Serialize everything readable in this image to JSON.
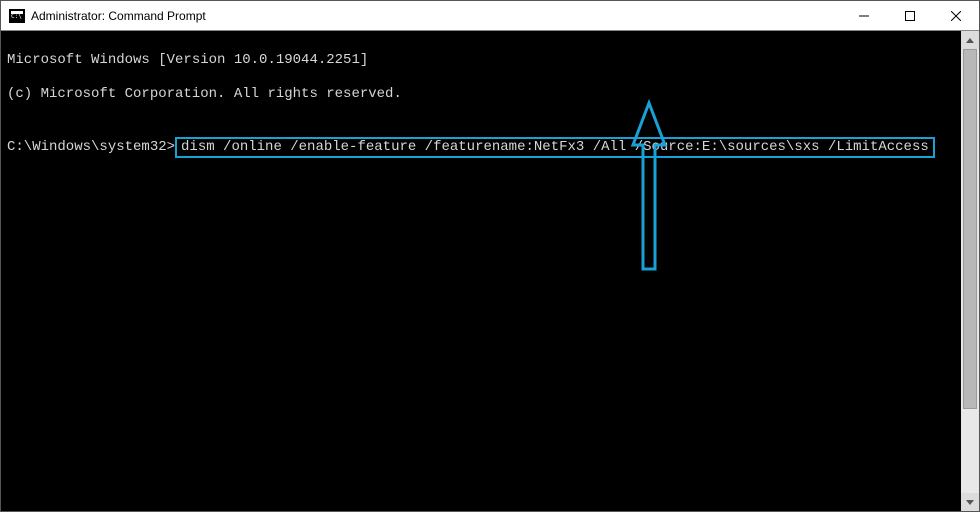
{
  "window": {
    "title": "Administrator: Command Prompt"
  },
  "terminal": {
    "line1": "Microsoft Windows [Version 10.0.19044.2251]",
    "line2": "(c) Microsoft Corporation. All rights reserved.",
    "blank": "",
    "prompt": "C:\\Windows\\system32>",
    "command": "dism /online /enable-feature /featurename:NetFx3 /All /Source:E:\\sources\\sxs /LimitAccess"
  },
  "annotation": {
    "highlight_color": "#18a1d6"
  }
}
